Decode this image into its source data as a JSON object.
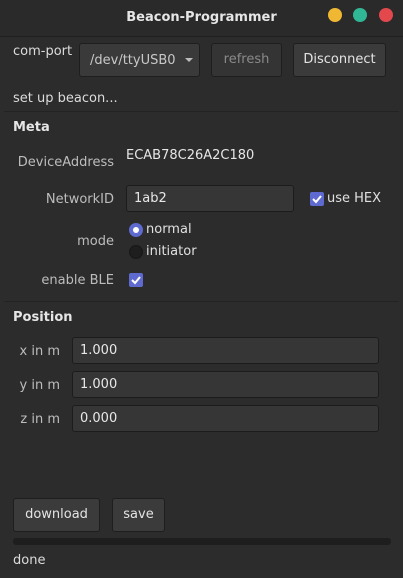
{
  "window": {
    "title": "Beacon-Programmer",
    "controls": {
      "minimize_color": "#f0b832",
      "maximize_color": "#30b896",
      "close_color": "#e3484d"
    }
  },
  "connection": {
    "com_port_label": "com-port",
    "port_value": "/dev/ttyUSB0",
    "refresh_label": "refresh",
    "disconnect_label": "Disconnect"
  },
  "setup_text": "set up beacon...",
  "meta": {
    "heading": "Meta",
    "device_address_label": "DeviceAddress",
    "device_address_value": "ECAB78C26A2C180",
    "network_id_label": "NetworkID",
    "network_id_value": "1ab2",
    "use_hex_label": "use HEX",
    "use_hex_checked": true,
    "mode_label": "mode",
    "mode_options": [
      "normal",
      "initiator"
    ],
    "mode_selected": "normal",
    "enable_ble_label": "enable BLE",
    "enable_ble_checked": true
  },
  "position": {
    "heading": "Position",
    "x_label": "x in m",
    "x_value": "1.000",
    "y_label": "y in m",
    "y_value": "1.000",
    "z_label": "z in m",
    "z_value": "0.000"
  },
  "actions": {
    "download_label": "download",
    "save_label": "save"
  },
  "status": {
    "text": "done",
    "progress": 0
  },
  "colors": {
    "accent": "#5f6ad0",
    "background": "#2c2c2c"
  }
}
